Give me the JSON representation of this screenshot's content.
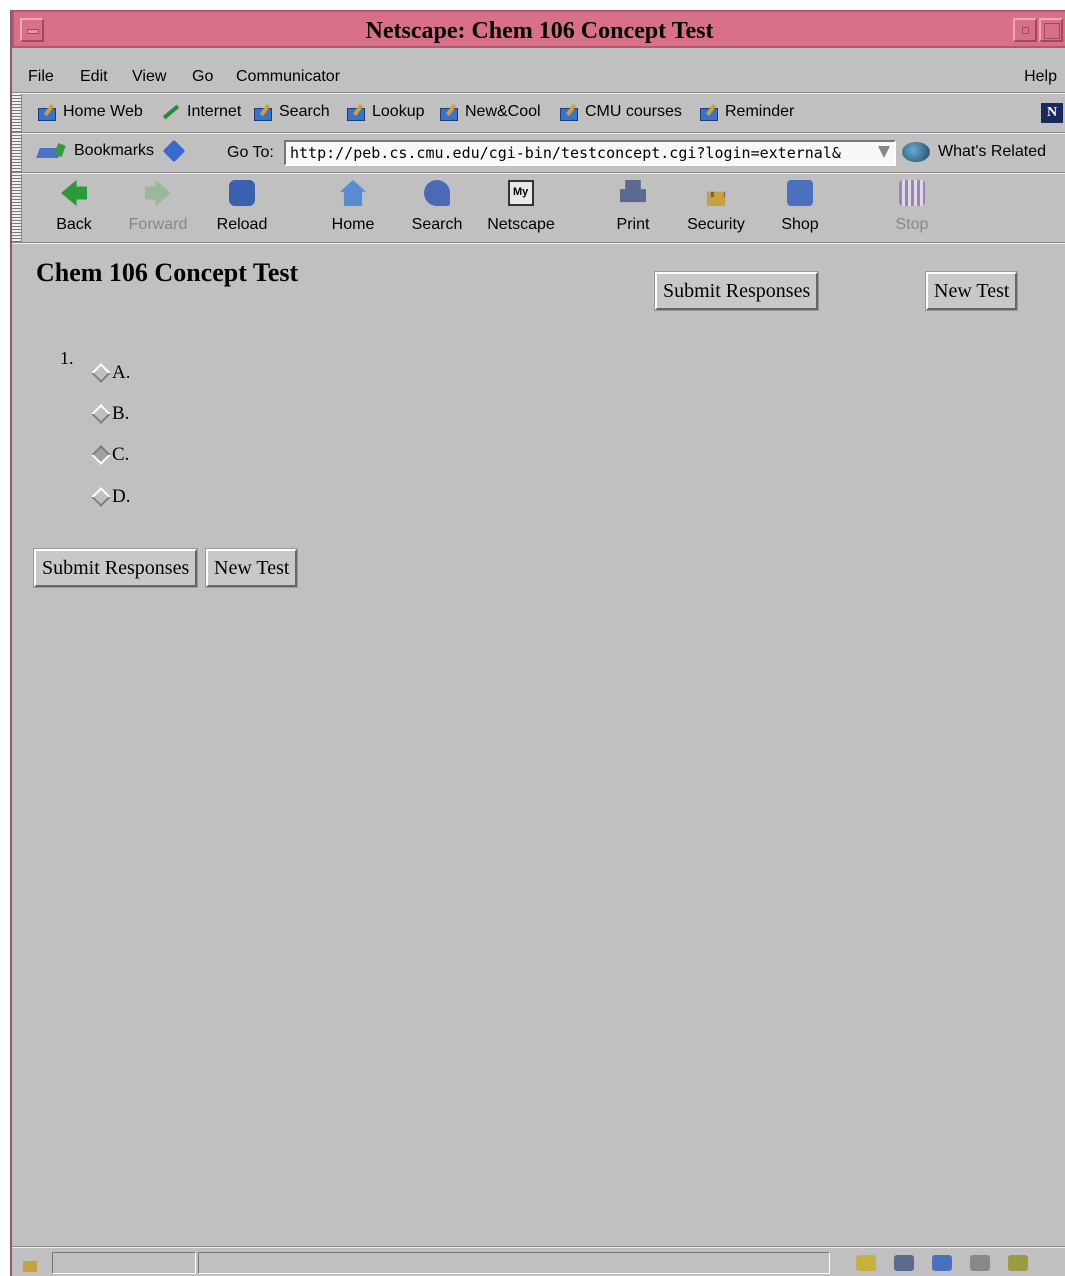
{
  "window": {
    "title": "Netscape: Chem 106 Concept Test"
  },
  "menubar": {
    "items": [
      "File",
      "Edit",
      "View",
      "Go",
      "Communicator"
    ],
    "help": "Help"
  },
  "personal_toolbar": {
    "items": [
      "Home Web",
      "Internet",
      "Search",
      "Lookup",
      "New&Cool",
      "CMU courses",
      "Reminder"
    ],
    "logo": "N"
  },
  "location_bar": {
    "bookmarks_label": "Bookmarks",
    "goto_label": "Go To:",
    "url": "http://peb.cs.cmu.edu/cgi-bin/testconcept.cgi?login=external&",
    "related_label": "What's Related"
  },
  "navigation_toolbar": {
    "buttons": [
      {
        "label": "Back",
        "icon": "back-arrow-icon",
        "enabled": true
      },
      {
        "label": "Forward",
        "icon": "forward-arrow-icon",
        "enabled": false
      },
      {
        "label": "Reload",
        "icon": "reload-icon",
        "enabled": true
      },
      {
        "label": "Home",
        "icon": "home-icon",
        "enabled": true
      },
      {
        "label": "Search",
        "icon": "search-icon",
        "enabled": true
      },
      {
        "label": "Netscape",
        "icon": "my-netscape-icon",
        "enabled": true
      },
      {
        "label": "Print",
        "icon": "printer-icon",
        "enabled": true
      },
      {
        "label": "Security",
        "icon": "padlock-icon",
        "enabled": true
      },
      {
        "label": "Shop",
        "icon": "shop-icon",
        "enabled": true
      },
      {
        "label": "Stop",
        "icon": "stop-icon",
        "enabled": false
      }
    ]
  },
  "page": {
    "title": "Chem 106 Concept Test",
    "submit_label": "Submit Responses",
    "new_test_label": "New Test",
    "question": {
      "number": "1.",
      "options": [
        {
          "label": "A.",
          "selected": false
        },
        {
          "label": "B.",
          "selected": false
        },
        {
          "label": "C.",
          "selected": true
        },
        {
          "label": "D.",
          "selected": false
        }
      ]
    }
  },
  "colors": {
    "titlebar": "#d8708a",
    "chrome": "#c0c0c0"
  }
}
